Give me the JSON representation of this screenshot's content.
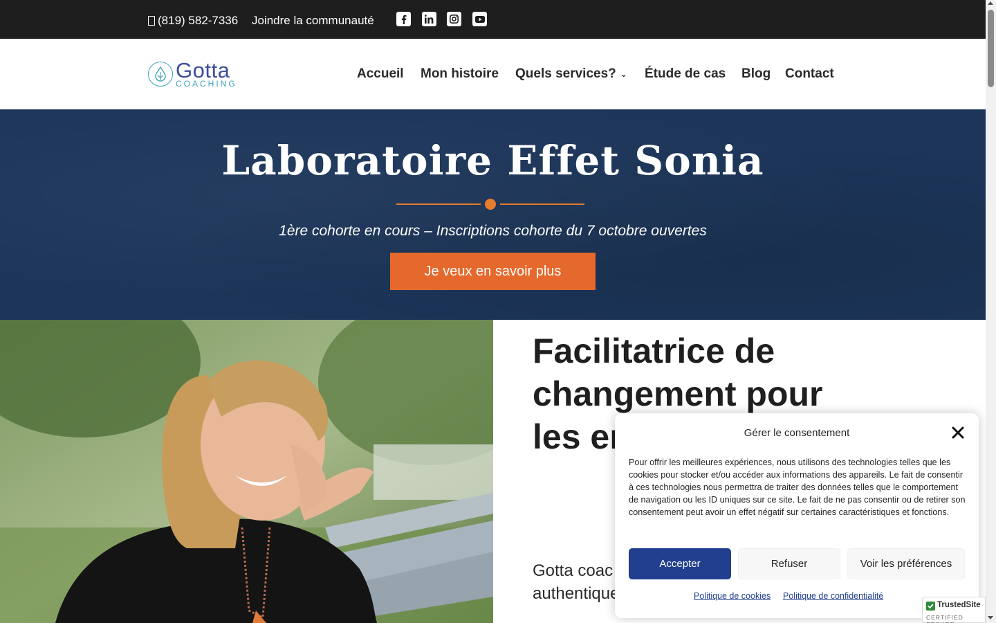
{
  "topbar": {
    "phone": "(819) 582-7336",
    "community": "Joindre la communauté",
    "social_icons": [
      "facebook-icon",
      "linkedin-icon",
      "instagram-icon",
      "youtube-icon"
    ]
  },
  "header": {
    "logo_word": "Gotta",
    "logo_sub": "COACHING",
    "nav": {
      "home": "Accueil",
      "story": "Mon histoire",
      "services": "Quels services?",
      "case": "Étude de cas",
      "blog": "Blog",
      "contact": "Contact"
    }
  },
  "hero": {
    "title": "Laboratoire Effet Sonia",
    "subtitle": "1ère cohorte en cours – Inscriptions cohorte du 7 octobre ouvertes",
    "cta": "Je veux en savoir plus"
  },
  "main": {
    "title": "Facilitatrice de changement pour les en pour perso",
    "body": "Gotta coac coaching s leadership authentique et gestion de"
  },
  "consent": {
    "title": "Gérer le consentement",
    "text": "Pour offrir les meilleures expériences, nous utilisons des technologies telles que les cookies pour stocker et/ou accéder aux informations des appareils. Le fait de consentir à ces technologies nous permettra de traiter des données telles que le comportement de navigation ou les ID uniques sur ce site. Le fait de ne pas consentir ou de retirer son consentement peut avoir un effet négatif sur certaines caractéristiques et fonctions.",
    "accept": "Accepter",
    "refuse": "Refuser",
    "prefs": "Voir les préférences",
    "cookie_policy": "Politique de cookies",
    "privacy_policy": "Politique de confidentialité"
  },
  "badge": {
    "name": "TrustedSite",
    "cert": "CERTIFIED SECURE"
  },
  "colors": {
    "topbar": "#1f1e1e",
    "hero": "#1c3559",
    "accent": "#e5692d",
    "brand_blue": "#3d4e9c",
    "accept_button": "#223f8f"
  }
}
